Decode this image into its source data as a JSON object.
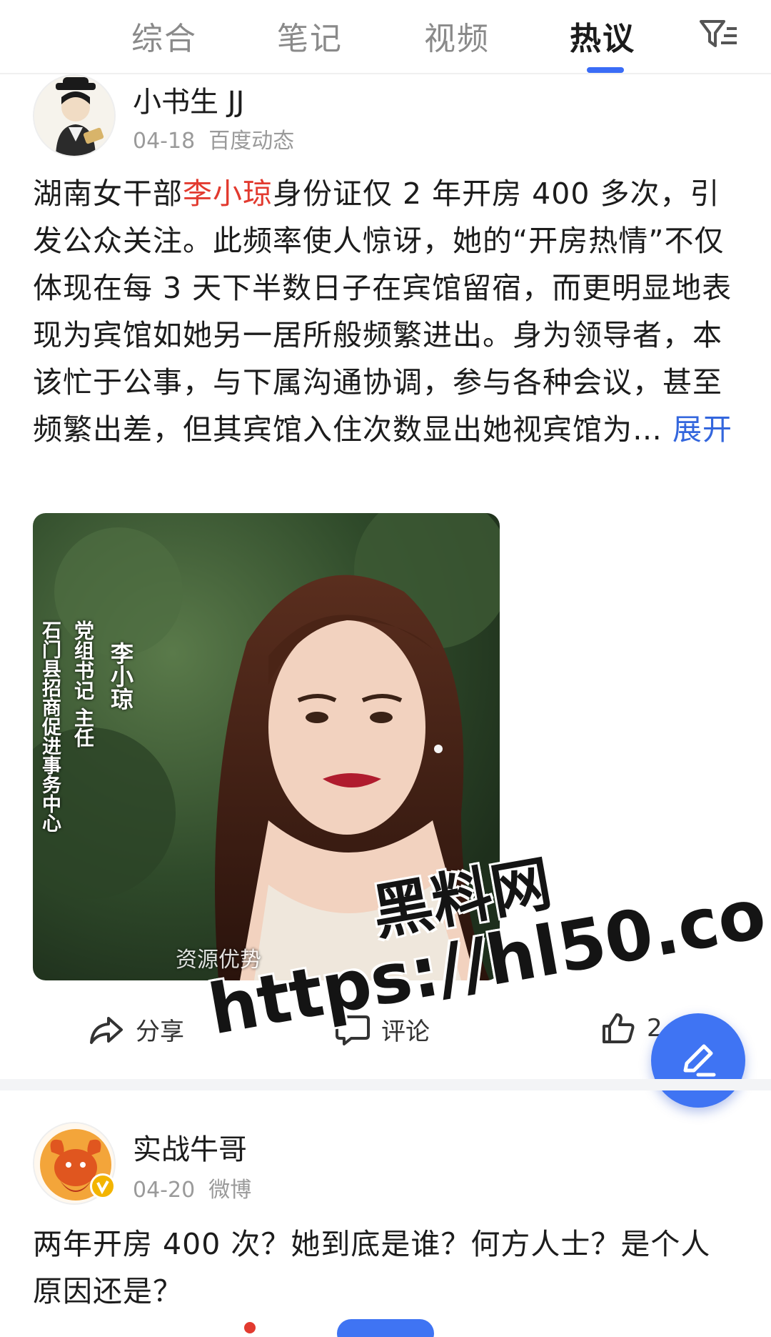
{
  "tabs": [
    {
      "label": "综合"
    },
    {
      "label": "笔记"
    },
    {
      "label": "视频"
    },
    {
      "label": "热议"
    }
  ],
  "active_tab": "热议",
  "posts": [
    {
      "author": "小书生 JJ",
      "date": "04-18",
      "source": "百度动态",
      "text_before": "湖南女干部",
      "text_highlight": "李小琼",
      "text_after": "身份证仅 2 年开房 400 多次，引发公众关注。此频率使人惊讶，她的“开房热情”不仅体现在每 3 天下半数日子在宾馆留宿，而更明显地表现为宾馆如她另一居所般频繁进出。身为领导者，本该忙于公事，与下属沟通协调，参与各种会议，甚至频繁出差，但其宾馆入住次数显出她视宾馆为…",
      "more_label": "展开",
      "image": {
        "caption_name": "李小琼",
        "caption_title": "党组书记 主任",
        "caption_org": "石门县招商促进事务中心",
        "caption_bottom": "资源优势"
      },
      "actions": {
        "share": "分享",
        "comment": "评论",
        "like_count": "2"
      }
    },
    {
      "author": "实战牛哥",
      "date": "04-20",
      "source": "微博",
      "text": "两年开房 400 次？她到底是谁？何方人士？是个人原因还是？"
    }
  ],
  "watermark": {
    "line1": "黑料网",
    "line2": "https://hl50.co"
  },
  "colors": {
    "accent": "#3f74f3",
    "highlight": "#e23a2f",
    "more_link": "#3366dd"
  }
}
